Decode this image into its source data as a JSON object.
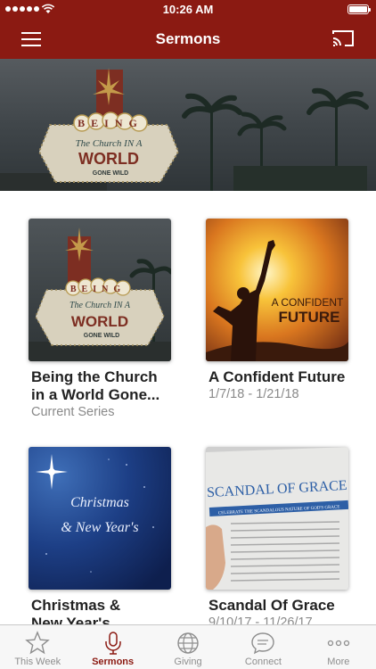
{
  "status_bar": {
    "time": "10:26 AM"
  },
  "nav": {
    "title": "Sermons",
    "menu_icon": "hamburger-menu-icon",
    "cast_icon": "cast-icon"
  },
  "hero": {
    "artwork_text": [
      "BEING",
      "The Church IN A",
      "WORLD",
      "GONE WILD"
    ]
  },
  "sermons": [
    {
      "title_line1": "Being the Church",
      "title_line2": "in a World Gone...",
      "subtitle": "Current Series",
      "artwork_text": [
        "BEING",
        "The Church IN A",
        "WORLD",
        "GONE WILD"
      ]
    },
    {
      "title_line1": "A Confident Future",
      "title_line2": "",
      "subtitle": "1/7/18 - 1/21/18",
      "artwork_text": [
        "A CONFIDENT",
        "FUTURE"
      ]
    },
    {
      "title_line1": "Christmas &",
      "title_line2": "New Year's",
      "subtitle": "",
      "artwork_text": [
        "Christmas",
        "& New Year's"
      ]
    },
    {
      "title_line1": "Scandal Of Grace",
      "title_line2": "",
      "subtitle": "9/10/17 - 11/26/17",
      "artwork_text": [
        "SCANDAL OF GRACE",
        "CELEBRATE THE SCANDALOUS NATURE OF GOD'S GRACE"
      ]
    }
  ],
  "tabs": [
    {
      "label": "This Week",
      "icon": "star-icon",
      "active": false
    },
    {
      "label": "Sermons",
      "icon": "microphone-icon",
      "active": true
    },
    {
      "label": "Giving",
      "icon": "globe-icon",
      "active": false
    },
    {
      "label": "Connect",
      "icon": "chat-bubble-icon",
      "active": false
    },
    {
      "label": "More",
      "icon": "more-dots-icon",
      "active": false
    }
  ],
  "colors": {
    "brand": "#8b1a12",
    "tab_inactive": "#8e8e8e",
    "subtitle": "#8a8a8a"
  }
}
